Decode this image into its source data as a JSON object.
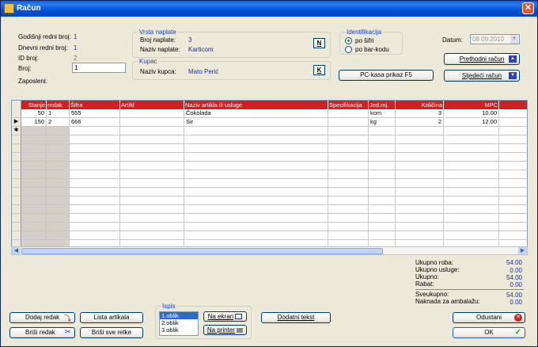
{
  "window": {
    "title": "Račun",
    "close_glyph": "✕"
  },
  "header": {
    "godisnji_label": "Godišnji redni broj:",
    "godisnji_value": "1",
    "dnevni_label": "Dnevni redni broj:",
    "dnevni_value": "1",
    "id_label": "ID broj:",
    "id_value": "2",
    "broj_label": "Broj:",
    "broj_value": "1",
    "zaposleni_label": "Zaposleni:"
  },
  "vrsta_naplate": {
    "legend": "Vrsta naplate",
    "broj_label": "Broj naplate:",
    "broj_value": "3",
    "naziv_label": "Naziv naplate:",
    "naziv_value": "Karticom",
    "button": "N"
  },
  "kupac": {
    "legend": "Kupac",
    "naziv_label": "Naziv kupca:",
    "naziv_value": "Mato Perić",
    "button": "K"
  },
  "identifikacija": {
    "legend": "Identifikacija",
    "options": [
      "po šifri",
      "po bar-kodu"
    ],
    "selected": "po šifri"
  },
  "datum": {
    "label": "Datum:",
    "value": "08.09.2010"
  },
  "buttons": {
    "pc_kasa": "PC-kasa prikaz  F5",
    "prethodni": "Prethodni račun",
    "sljedeci": "Sljedeći račun",
    "dodaj_redak": "Dodaj redak",
    "brisi_redak": "Briši redak",
    "lista_artikala": "Lista artikala",
    "brisi_sve": "Briši sve retke",
    "na_ekran": "Na ekran",
    "na_printer": "Na printer",
    "dodatni_tekst": "Dodatni tekst",
    "odustani": "Odustani",
    "ok": "OK"
  },
  "table": {
    "columns": [
      "Stanje",
      "redak",
      "Šifra",
      "Artikl",
      "Naziv artikla ili usluge",
      "Specifikacija",
      "Jed.mj.",
      "Količina",
      "MPC"
    ],
    "rows": [
      {
        "stanje": "50",
        "redak": "1",
        "sifra": "555",
        "artikl": "",
        "naziv": "Čokolada",
        "spec": "",
        "jedmj": "kom",
        "kolicina": "3",
        "mpc": "10.00"
      },
      {
        "stanje": "150",
        "redak": "2",
        "sifra": "666",
        "artikl": "",
        "naziv": "Sir",
        "spec": "",
        "jedmj": "kg",
        "kolicina": "2",
        "mpc": "12.00"
      }
    ],
    "new_row_marker": "✱",
    "current_row_marker": "▶"
  },
  "ispis": {
    "legend": "Ispis",
    "options": [
      "1.oblik",
      "2.oblik",
      "3.oblik"
    ],
    "selected": "1.oblik"
  },
  "totals": {
    "ukupno_roba_label": "Ukupno roba:",
    "ukupno_roba": "54.00",
    "ukupno_usluge_label": "Ukupno usluge:",
    "ukupno_usluge": "0.00",
    "ukupno_label": "Ukupno:",
    "ukupno": "54.00",
    "rabat_label": "Rabat:",
    "rabat": "0.00",
    "sveukupno_label": "Sveukupno:",
    "sveukupno": "54.00",
    "naknada_label": "Naknada za ambalažu:",
    "naknada": "0.00"
  },
  "colors": {
    "title_bar": "#0052d6",
    "header_red": "#d31f1f",
    "value_blue": "#1b2d9e",
    "legend_blue": "#1d3fbf"
  }
}
